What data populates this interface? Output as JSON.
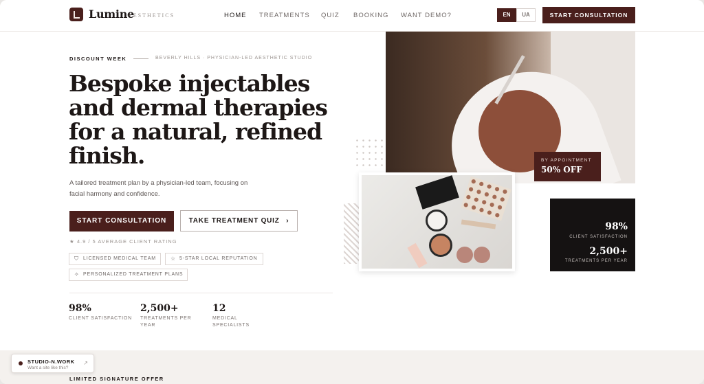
{
  "brand": {
    "name": "Lumine",
    "tagline": "AESTHETICS"
  },
  "nav": [
    {
      "label": "HOME"
    },
    {
      "label": "TREATMENTS"
    },
    {
      "label": "QUIZ"
    },
    {
      "label": "BOOKING"
    },
    {
      "label": "WANT DEMO?"
    }
  ],
  "languages": [
    "EN",
    "UA"
  ],
  "header": {
    "cta": "START CONSULTATION"
  },
  "hero": {
    "eyebrow": "DISCOUNT WEEK",
    "eyebrow_sub": "BEVERLY HILLS · PHYSICIAN-LED AESTHETIC STUDIO",
    "headline": "Bespoke injectables and dermal therapies for a natural, refined finish.",
    "lead": "A tailored treatment plan by a physician-led team, focusing on facial harmony and confidence.",
    "primary_cta": "START CONSULTATION",
    "secondary_cta": "TAKE TREATMENT QUIZ",
    "rating": "4.9 / 5 AVERAGE CLIENT RATING",
    "chips": [
      {
        "icon": "shield-icon",
        "label": "LICENSED MEDICAL TEAM"
      },
      {
        "icon": "star-icon",
        "label": "5-STAR LOCAL REPUTATION"
      },
      {
        "icon": "sparkle-icon",
        "label": "PERSONALIZED TREATMENT PLANS"
      }
    ],
    "stats": [
      {
        "value": "98%",
        "label": "CLIENT SATISFACTION"
      },
      {
        "value": "2,500+",
        "label": "TREATMENTS PER YEAR"
      },
      {
        "value": "12",
        "label": "MEDICAL SPECIALISTS"
      }
    ]
  },
  "promo": {
    "top": "BY APPOINTMENT",
    "value": "50% OFF"
  },
  "stat_card": [
    {
      "value": "98%",
      "label": "CLIENT SATISFACTION"
    },
    {
      "value": "2,500+",
      "label": "TREATMENTS PER YEAR"
    }
  ],
  "bottom": {
    "offer": "LIMITED SIGNATURE OFFER"
  },
  "toast": {
    "title": "STUDIO-N.WORK",
    "subtitle": "Want a site like this?"
  },
  "colors": {
    "accent": "#4a1f1c",
    "dark": "#151212",
    "text": "#1d1716"
  }
}
